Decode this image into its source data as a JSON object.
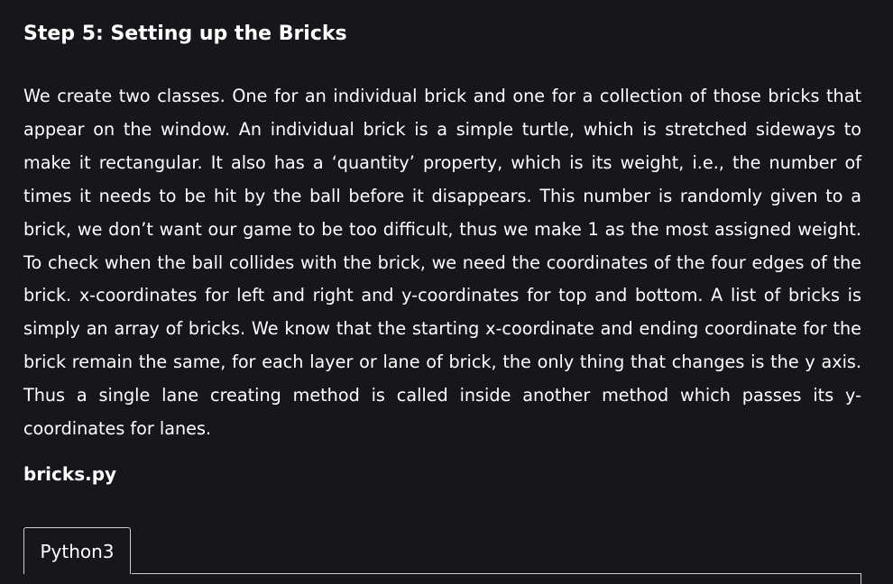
{
  "article": {
    "step_title": "Step 5: Setting up the Bricks",
    "paragraph": "We create two classes. One for an individual brick and one for a collection of those bricks that appear on the window. An individual brick is a simple turtle, which is stretched sideways to make it rectangular. It also has a ‘quantity’ property, which is its weight, i.e., the number of times it needs to be hit by the ball before it disappears. This number is randomly given to a brick, we don’t want our game to be too difficult, thus we make 1 as the most assigned weight. To check when the ball collides with the brick, we need the coordinates of the four edges of the brick. x-coordinates for left and right and y-coordinates for top and bottom. A list of bricks is simply an array of bricks. We know that the starting x-coordinate and ending coordinate for the brick remain the same, for each layer or lane of brick, the only thing that changes is the y axis. Thus a single lane creating method is called inside another method which passes its y-coordinates for lanes.",
    "file_name": "bricks.py"
  },
  "code_block": {
    "tabs": [
      {
        "label": "Python3",
        "active": true
      }
    ]
  },
  "colors": {
    "background": "#16161b",
    "text": "#ffffff",
    "border": "#cfcfcf"
  }
}
